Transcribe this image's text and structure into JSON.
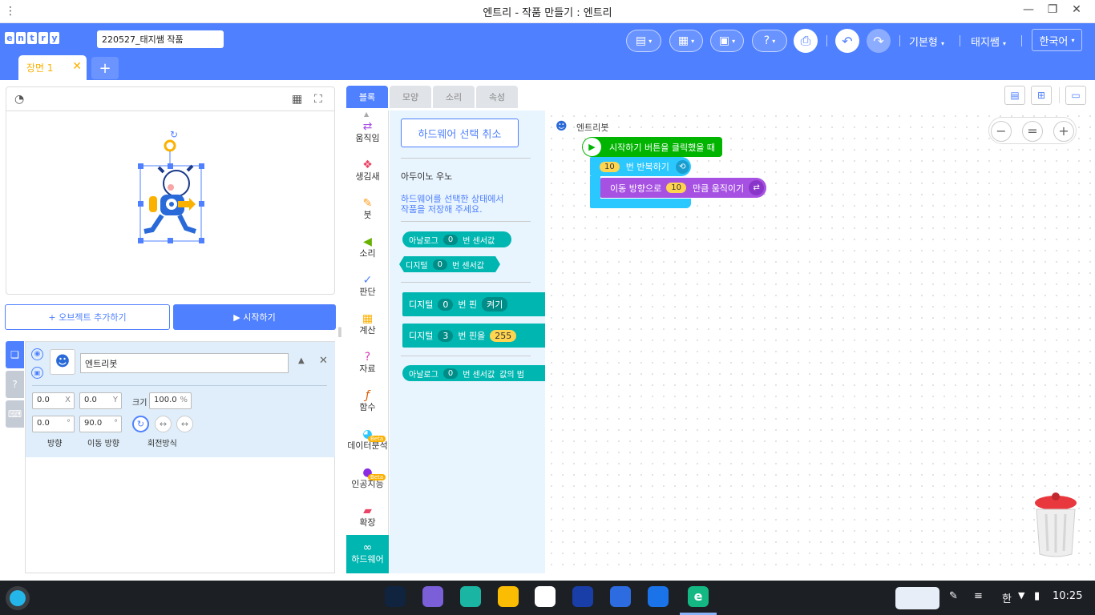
{
  "window": {
    "title": "엔트리 - 작품 만들기 : 엔트리",
    "menu_dots": "⋮",
    "minimize": "—",
    "restore": "❐",
    "close": "✕"
  },
  "header": {
    "logo": [
      "e",
      "n",
      "t",
      "r",
      "y"
    ],
    "project_name": "220527_태지쌤 작품",
    "mode": "기본형",
    "user": "태지쌤",
    "language": "한국어"
  },
  "scene": {
    "tab_label": "장면 1",
    "close": "✕",
    "add": "+"
  },
  "stage": {
    "add_object": "+ 오브젝트 추가하기",
    "start": "▶ 시작하기"
  },
  "object": {
    "name": "엔트리봇",
    "x": "0.0",
    "x_unit": "X",
    "y": "0.0",
    "y_unit": "Y",
    "size_label": "크기",
    "size": "100.0",
    "size_unit": "%",
    "direction": "0.0",
    "direction_unit": "°",
    "move_direction": "90.0",
    "move_direction_unit": "°",
    "direction_label": "방향",
    "move_direction_label": "이동 방향",
    "rotation_label": "회전방식"
  },
  "tabs": [
    "블록",
    "모양",
    "소리",
    "속성"
  ],
  "categories": [
    "움직임",
    "생김새",
    "붓",
    "소리",
    "판단",
    "계산",
    "자료",
    "함수",
    "데이터분석",
    "인공지능",
    "확장",
    "하드웨어"
  ],
  "beta": "Beta",
  "palette": {
    "cancel_hw": "하드웨어 선택 취소",
    "device": "아두이노 우노",
    "notice": "하드웨어를 선택한 상태에서 작품을 저장해 주세요.",
    "blocks": [
      {
        "a": "아날로그",
        "v": "0",
        "b": "번 센서값"
      },
      {
        "a": "디지털",
        "v": "0",
        "b": "번 센서값"
      },
      {
        "a": "디지털",
        "v": "0",
        "b": "번 핀",
        "c": "켜기"
      },
      {
        "a": "디지털",
        "v": "3",
        "b": "번 핀을",
        "n": "255"
      },
      {
        "a": "아날로그",
        "v": "0",
        "b": "번 센서값",
        "c": "값의 범"
      }
    ]
  },
  "code": {
    "object_label": "엔트리봇",
    "when_start": "시작하기 버튼을 클릭했을 때",
    "repeat_count": "10",
    "repeat_label": "번 반복하기",
    "move_prefix": "이동 방향으로",
    "move_count": "10",
    "move_suffix": "만큼 움직이기"
  },
  "zoom": {
    "minus": "−",
    "reset": "=",
    "plus": "+"
  },
  "taskbar": {
    "time": "10:25",
    "ime": "한"
  },
  "colors": {
    "brand": "#4f80ff",
    "start_green": "#00b400",
    "loop_blue": "#2bc7ff",
    "move_purple": "#a751e3",
    "hw_teal": "#00b6b1",
    "accent_yellow": "#fbb100"
  }
}
